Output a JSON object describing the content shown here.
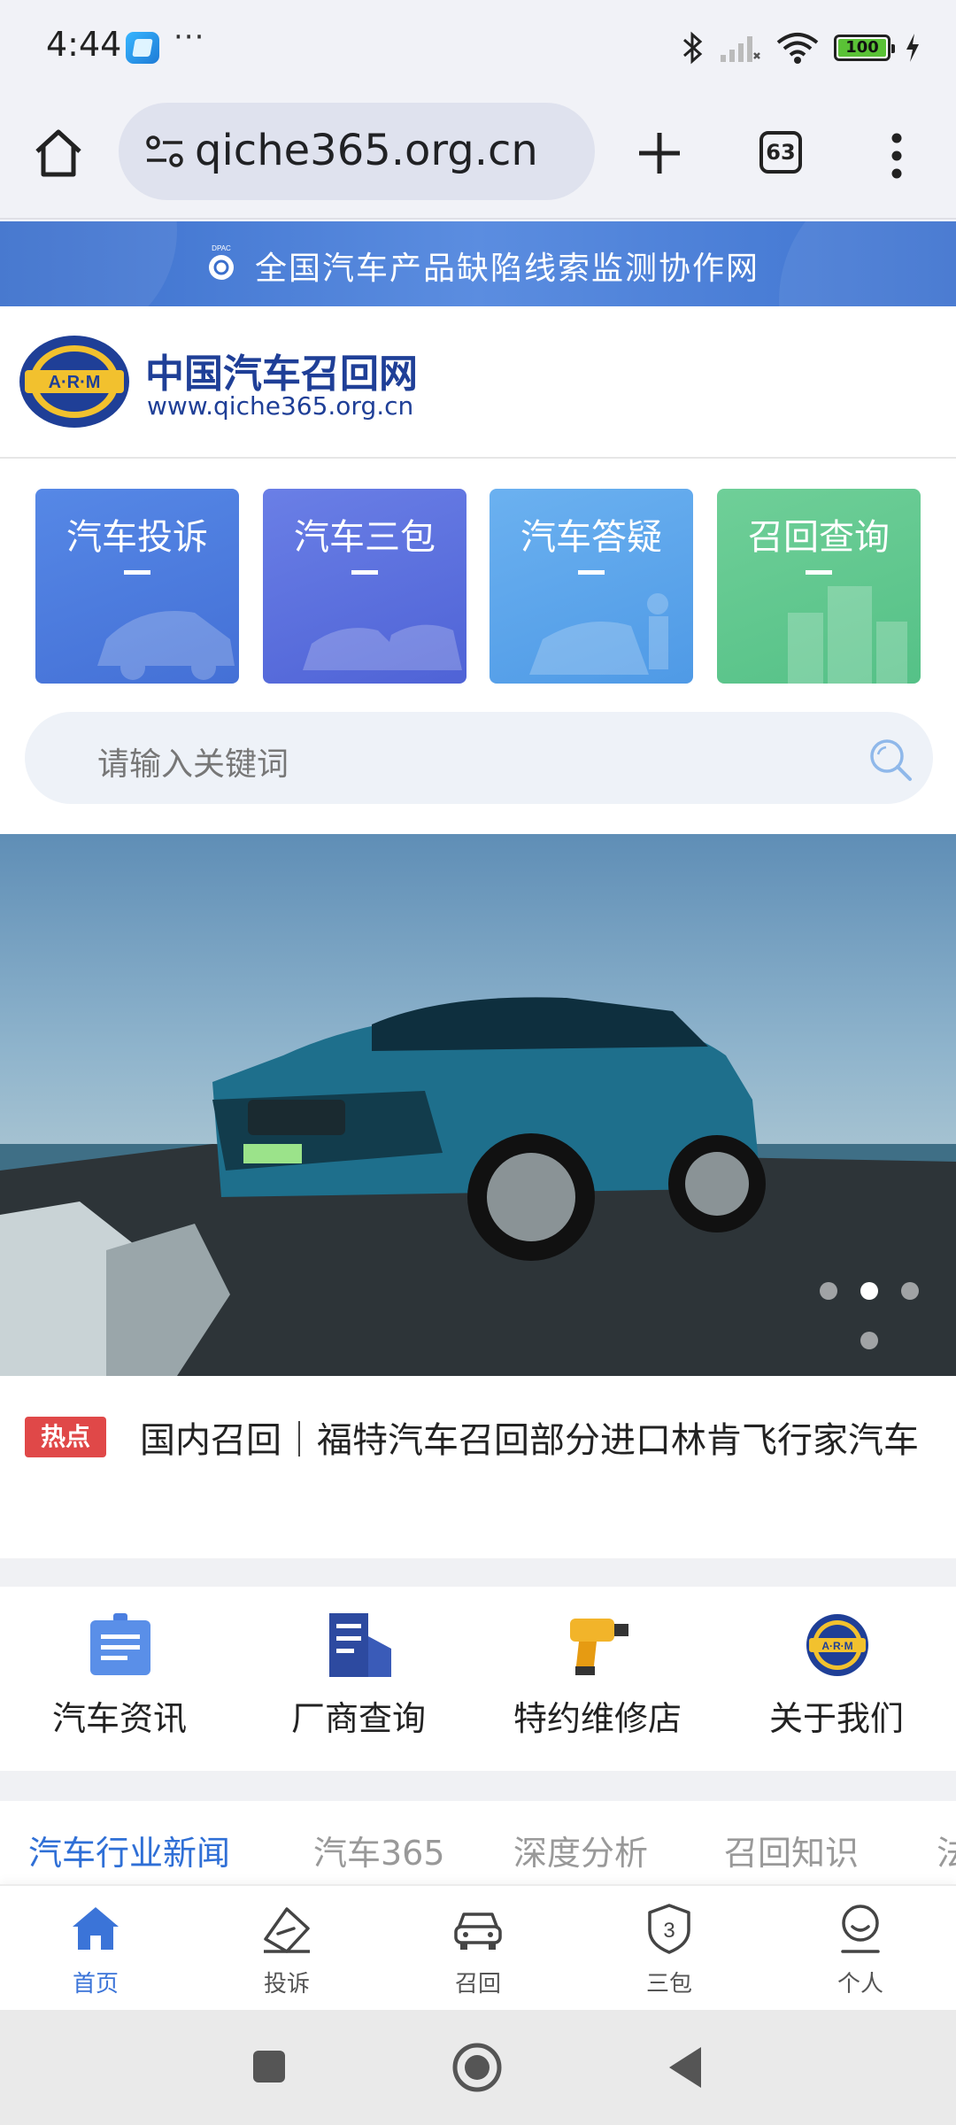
{
  "status_bar": {
    "time": "4:44",
    "more": "···",
    "battery": "100"
  },
  "browser": {
    "url": "qiche365.org.cn",
    "tab_count": "63"
  },
  "banner": {
    "text": "全国汽车产品缺陷线索监测协作网"
  },
  "site": {
    "title": "中国汽车召回网",
    "url": "www.qiche365.org.cn"
  },
  "quick_cards": [
    {
      "label": "汽车投诉",
      "color": "#4f7ee0"
    },
    {
      "label": "汽车三包",
      "color": "#5c73e0"
    },
    {
      "label": "汽车答疑",
      "color": "#5fa8ef"
    },
    {
      "label": "召回查询",
      "color": "#63c991"
    }
  ],
  "search": {
    "placeholder": "请输入关键词"
  },
  "hot_news": {
    "badge": "热点",
    "text": "国内召回｜福特汽车召回部分进口林肯飞行家汽车"
  },
  "grid": [
    {
      "label": "汽车资讯",
      "icon": "news-icon"
    },
    {
      "label": "厂商查询",
      "icon": "building-icon"
    },
    {
      "label": "特约维修店",
      "icon": "drill-icon"
    },
    {
      "label": "关于我们",
      "icon": "arm-logo-icon"
    }
  ],
  "categories": [
    "汽车行业新闻",
    "汽车365",
    "深度分析",
    "召回知识",
    "法"
  ],
  "bottom_nav": [
    {
      "label": "首页",
      "icon": "home-icon"
    },
    {
      "label": "投诉",
      "icon": "complaint-icon"
    },
    {
      "label": "召回",
      "icon": "car-icon"
    },
    {
      "label": "三包",
      "icon": "shield-3-icon"
    },
    {
      "label": "个人",
      "icon": "person-icon"
    }
  ],
  "colors": {
    "accent": "#3b74d8",
    "banner": "#4a80d8",
    "hot": "#e04848"
  }
}
